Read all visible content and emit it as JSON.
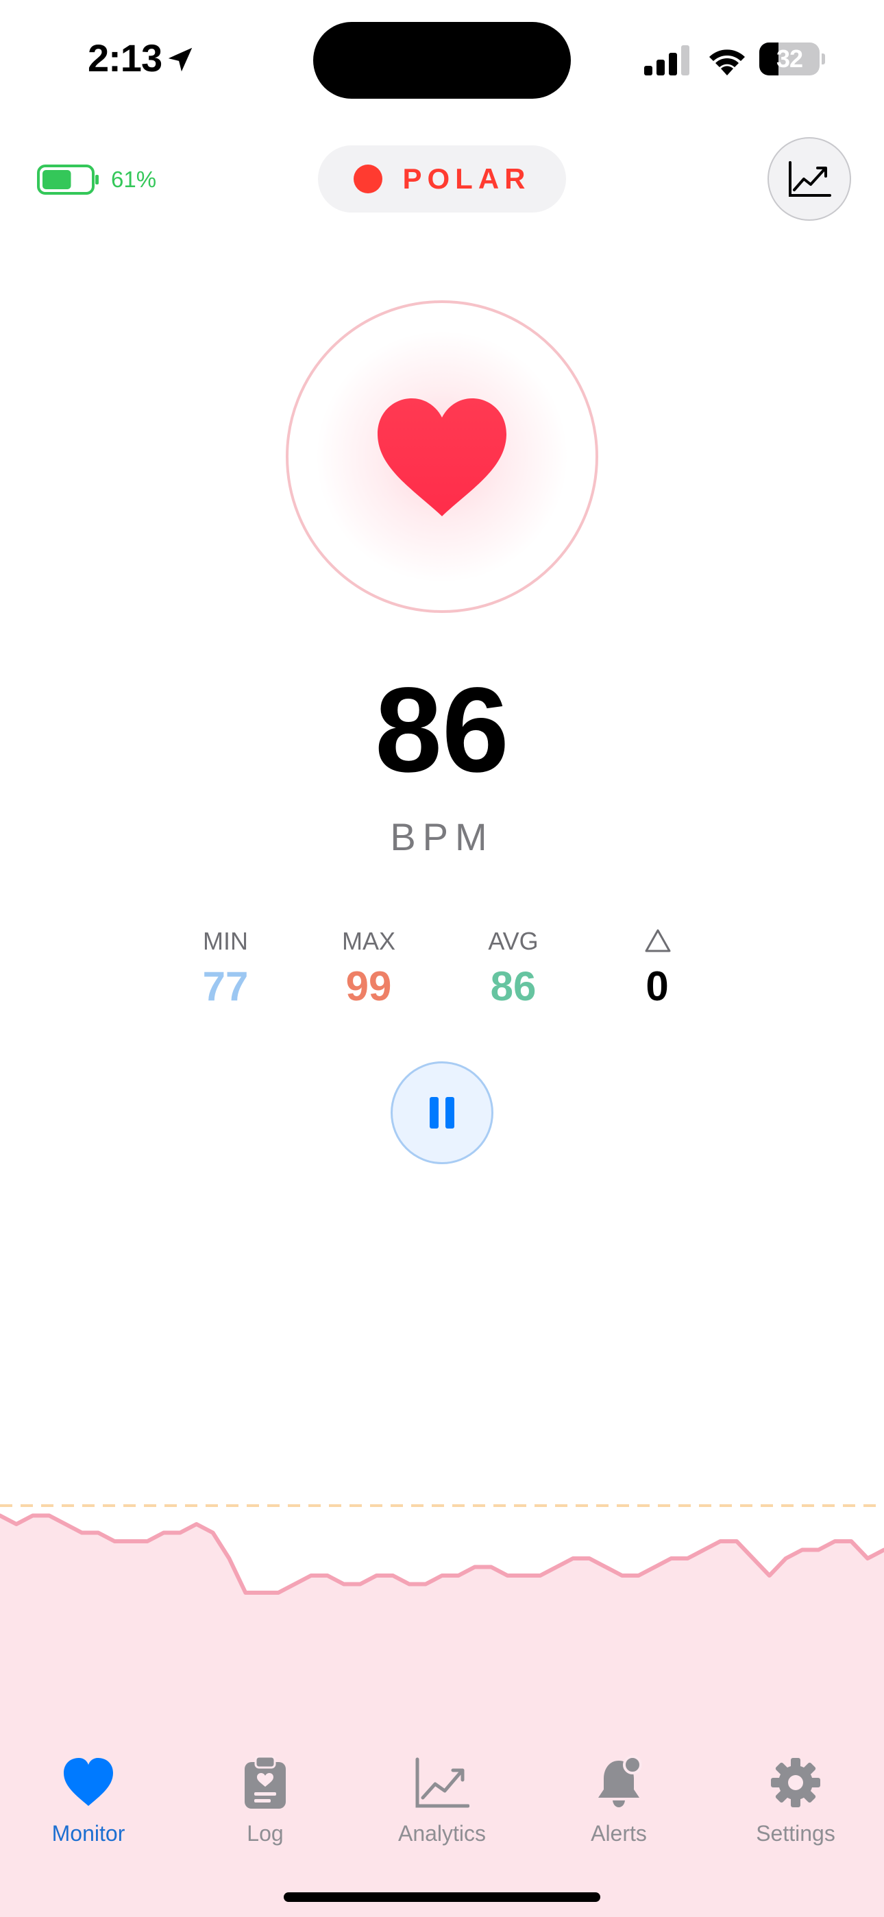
{
  "status_bar": {
    "time": "2:13",
    "battery_percent": "32",
    "battery_level": 0.32,
    "icons": [
      "location-arrow-icon",
      "cellular-signal-icon",
      "wifi-icon",
      "battery-icon"
    ]
  },
  "header": {
    "sensor_battery_text": "61%",
    "sensor_battery_level": 0.61,
    "device_name": "POLAR",
    "device_status_color": "#ff3b30",
    "chart_button_icon": "line-chart-icon"
  },
  "heart_rate": {
    "value": "86",
    "unit": "BPM",
    "icon": "heart-icon",
    "color": "#ff3b55"
  },
  "stats": [
    {
      "label": "MIN",
      "value": "77",
      "color": "#9cc7f2"
    },
    {
      "label": "MAX",
      "value": "99",
      "color": "#ee8066"
    },
    {
      "label": "AVG",
      "value": "86",
      "color": "#66c4a0"
    },
    {
      "label": "",
      "icon": "delta-triangle-icon",
      "value": "0",
      "color": "#000000"
    }
  ],
  "controls": {
    "pause_icon": "pause-icon",
    "accent": "#007aff"
  },
  "graph": {
    "line_color": "#f4a3b5",
    "fill_color": "#fde4ea",
    "threshold_color": "#fad7a8",
    "series": [
      88,
      87,
      88,
      88,
      87,
      86,
      86,
      85,
      85,
      85,
      86,
      86,
      87,
      86,
      83,
      79,
      79,
      79,
      80,
      81,
      81,
      80,
      80,
      81,
      81,
      80,
      80,
      81,
      81,
      82,
      82,
      81,
      81,
      81,
      82,
      83,
      83,
      82,
      81,
      81,
      82,
      83,
      83,
      84,
      85,
      85,
      83,
      81,
      83,
      84,
      84,
      85,
      85,
      83,
      84
    ]
  },
  "tab_bar": {
    "active_color": "#007aff",
    "inactive_color": "#8e8e93",
    "tabs": [
      {
        "label": "Monitor",
        "icon": "heart-icon",
        "active": true
      },
      {
        "label": "Log",
        "icon": "clipboard-icon",
        "active": false
      },
      {
        "label": "Analytics",
        "icon": "analytics-chart-icon",
        "active": false
      },
      {
        "label": "Alerts",
        "icon": "bell-icon",
        "active": false
      },
      {
        "label": "Settings",
        "icon": "gear-icon",
        "active": false
      }
    ]
  }
}
